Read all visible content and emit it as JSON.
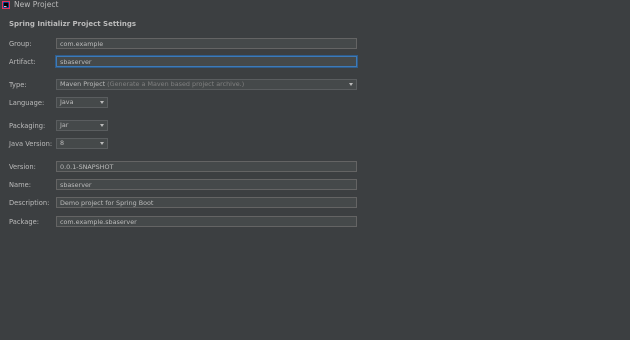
{
  "window": {
    "title": "New Project"
  },
  "section_title": "Spring Initializr Project Settings",
  "fields": {
    "group": {
      "label": "Group:",
      "value": "com.example"
    },
    "artifact": {
      "label": "Artifact:",
      "value": "sbaserver"
    },
    "type": {
      "label": "Type:",
      "value": "Maven Project",
      "hint": "(Generate a Maven based project archive.)"
    },
    "language": {
      "label": "Language:",
      "value": "Java"
    },
    "packaging": {
      "label": "Packaging:",
      "value": "Jar"
    },
    "java_version": {
      "label": "Java Version:",
      "value": "8"
    },
    "version": {
      "label": "Version:",
      "value": "0.0.1-SNAPSHOT"
    },
    "name": {
      "label": "Name:",
      "value": "sbaserver"
    },
    "description": {
      "label": "Description:",
      "value": "Demo project for Spring Boot"
    },
    "package": {
      "label": "Package:",
      "value": "com.example.sbaserver"
    }
  },
  "colors": {
    "background": "#3c3f41",
    "field_background": "#45494a",
    "focus_border": "#3d7ab8",
    "text": "#bbbbbb"
  },
  "icons": {
    "app": "intellij-idea-icon",
    "dropdown": "chevron-down-icon"
  }
}
